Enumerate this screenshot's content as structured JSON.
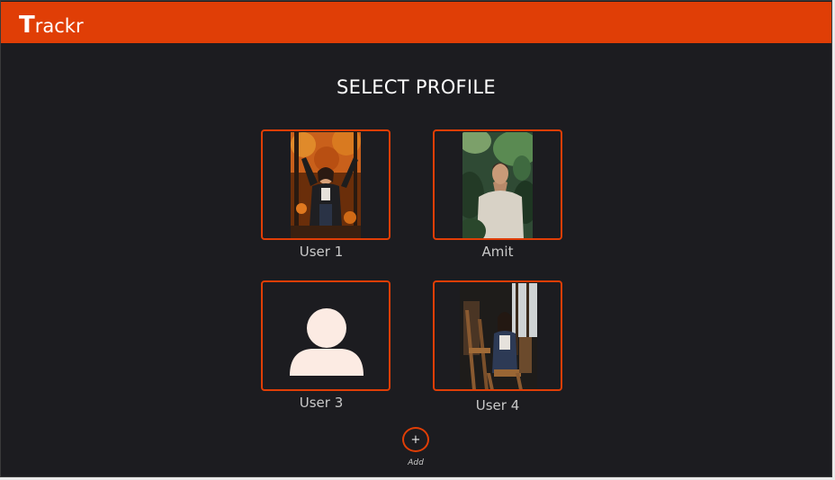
{
  "app": {
    "brand_first": "T",
    "brand_rest": "rackr"
  },
  "page": {
    "title": "SELECT PROFILE"
  },
  "profiles": [
    {
      "name": "User 1",
      "avatar": "photo-woman-autumn"
    },
    {
      "name": "Amit",
      "avatar": "photo-man-plants"
    },
    {
      "name": "User 3",
      "avatar": "default-user-icon"
    },
    {
      "name": "User 4",
      "avatar": "photo-woman-studio"
    }
  ],
  "add": {
    "icon": "+",
    "label": "Add"
  },
  "colors": {
    "accent": "#e03e06",
    "background": "#1c1c20",
    "text": "#ffffff",
    "label": "#c9c9c9"
  }
}
